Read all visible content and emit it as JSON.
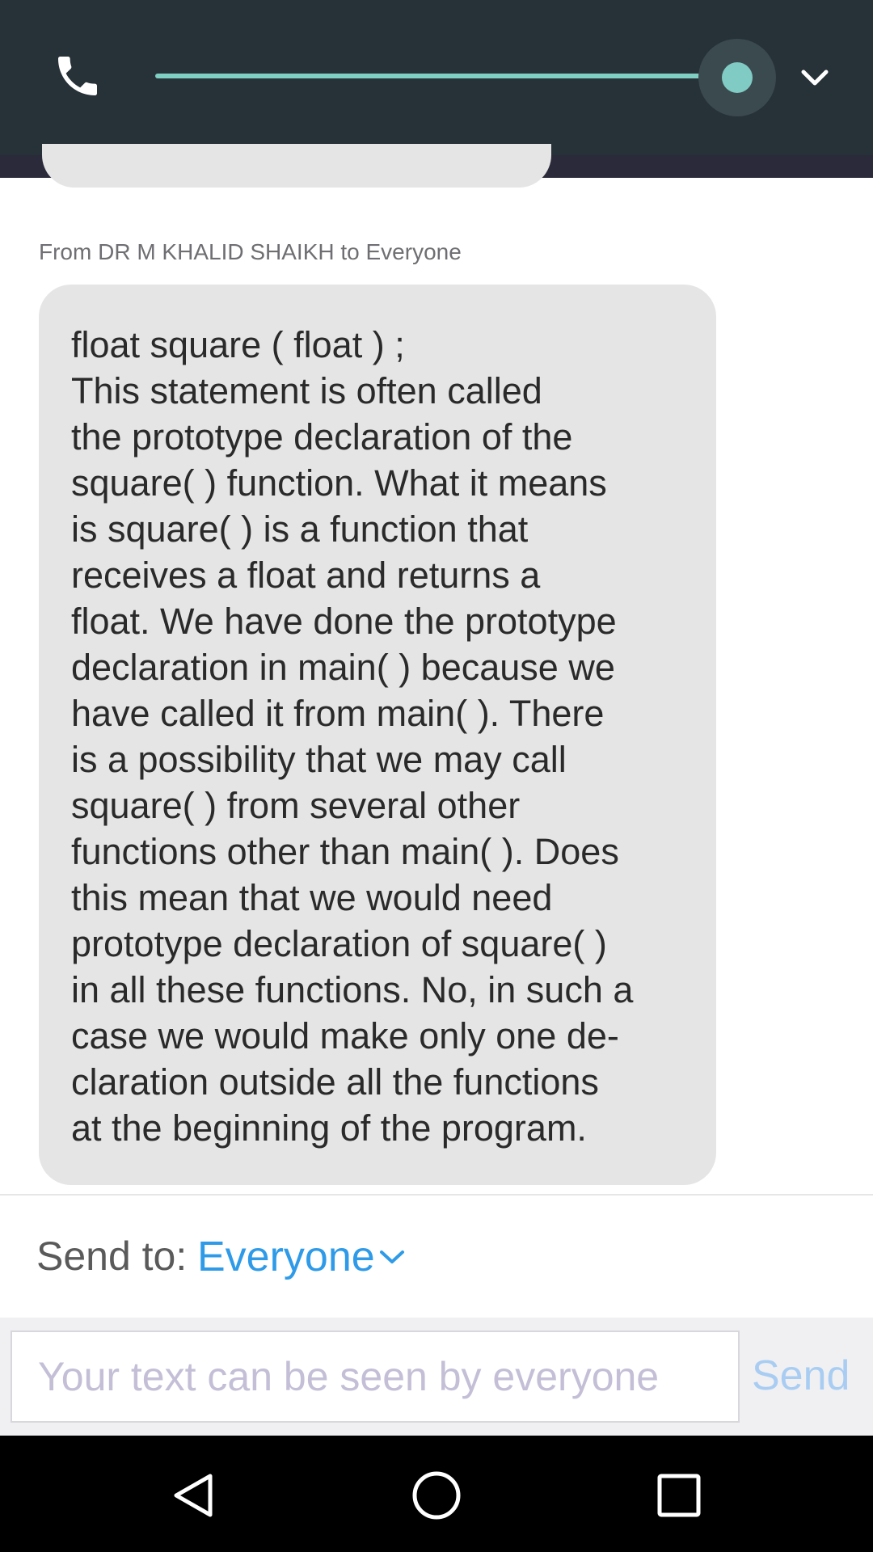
{
  "audio_bar": {
    "phone_icon": "phone-icon",
    "volume_level": 0.93,
    "collapse_icon": "chevron-down-icon"
  },
  "chat": {
    "message": {
      "sender_line": "From DR M KHALID SHAIKH to Everyone",
      "lines": [
        "float square ( float ) ;",
        "This statement is often called",
        "the prototype declaration of the",
        "square( ) function. What it means",
        "is square( ) is a function that",
        "receives a float and returns a",
        "float. We have done the prototype",
        "declaration in main( ) because we",
        "have called it from main( ). There",
        "is a possibility that we may call",
        "square( ) from several other",
        "functions other than main( ). Does",
        "this mean that we would need",
        "prototype declaration of square( )",
        "in all these functions. No, in such a",
        "case we would make only one de-",
        "claration outside all the functions",
        "at the beginning of the program."
      ]
    }
  },
  "send_to": {
    "label": "Send to:",
    "value": "Everyone"
  },
  "composer": {
    "placeholder": "Your text can be seen by everyone",
    "send_label": "Send"
  },
  "navbar": {
    "back_icon": "back-triangle-icon",
    "home_icon": "home-circle-icon",
    "recents_icon": "recents-square-icon"
  }
}
